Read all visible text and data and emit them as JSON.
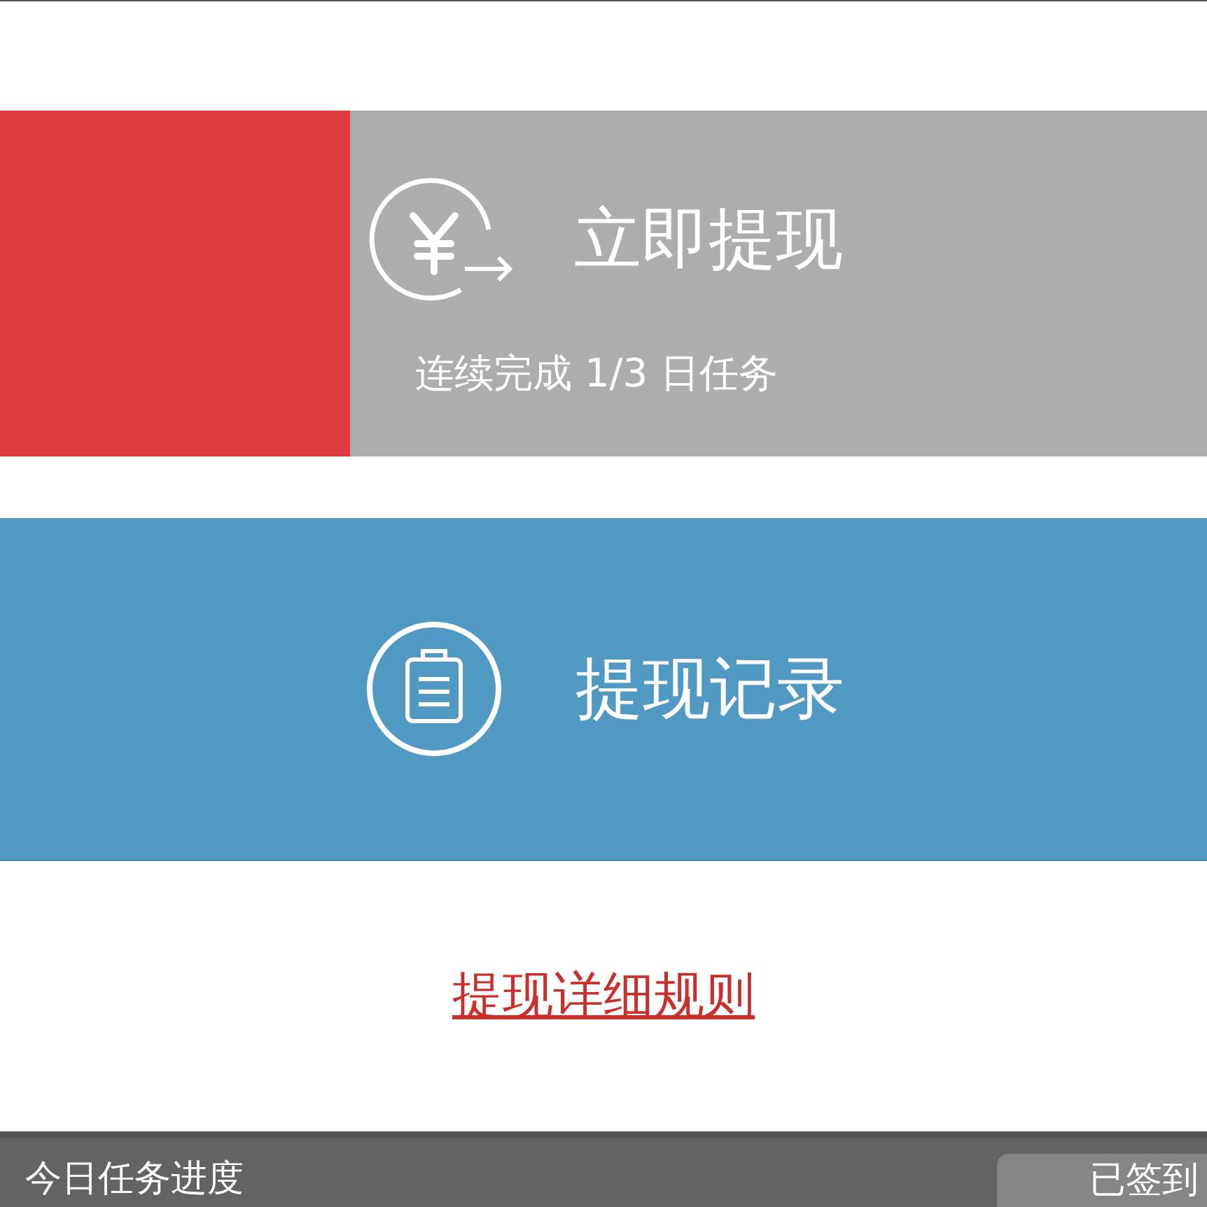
{
  "withdraw_button": {
    "label": "立即提现",
    "subtitle": "连续完成 1/3 日任务",
    "level": 0.29,
    "disabled": true
  },
  "records_button": {
    "label": "提现记录"
  },
  "rules_link": {
    "label": "提现详细规则"
  },
  "task_bar": {
    "title": "今日任务进度",
    "signin_button": {
      "label": "已签到"
    }
  }
}
